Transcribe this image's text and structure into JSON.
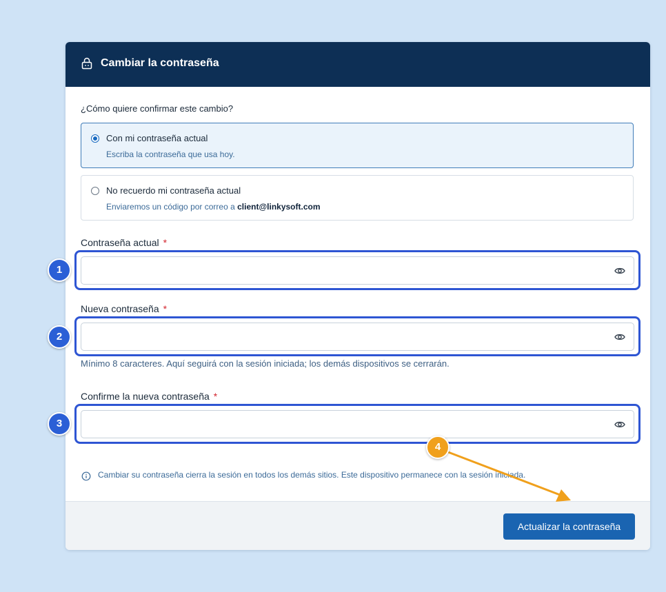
{
  "header": {
    "title": "Cambiar la contraseña",
    "icon": "lock-icon"
  },
  "question": "¿Cómo quiere confirmar este cambio?",
  "options": [
    {
      "label": "Con mi contraseña actual",
      "desc": "Escriba la contraseña que usa hoy.",
      "selected": true
    },
    {
      "label": "No recuerdo mi contraseña actual",
      "desc_prefix": "Enviaremos un código por correo a ",
      "email": "client@linkysoft.com",
      "selected": false
    }
  ],
  "fields": {
    "current": {
      "label": "Contraseña actual",
      "required": "*",
      "value": ""
    },
    "new": {
      "label": "Nueva contraseña",
      "required": "*",
      "value": ""
    },
    "confirm": {
      "label": "Confirme la nueva contraseña",
      "required": "*",
      "value": ""
    }
  },
  "help_text": "Mínimo 8 caracteres. Aquí seguirá con la sesión iniciada; los demás dispositivos se cerrarán.",
  "info_text": "Cambiar su contraseña cierra la sesión en todos los demás sitios. Este dispositivo permanece con la sesión iniciada.",
  "submit_label": "Actualizar la contraseña",
  "annotations": {
    "badge1": "1",
    "badge2": "2",
    "badge3": "3",
    "badge4": "4"
  },
  "colors": {
    "header_bg": "#0d2f55",
    "primary": "#1a64b1",
    "highlight": "#2e55d3",
    "accent_orange": "#f0a01c",
    "page_bg": "#cfe3f6"
  }
}
